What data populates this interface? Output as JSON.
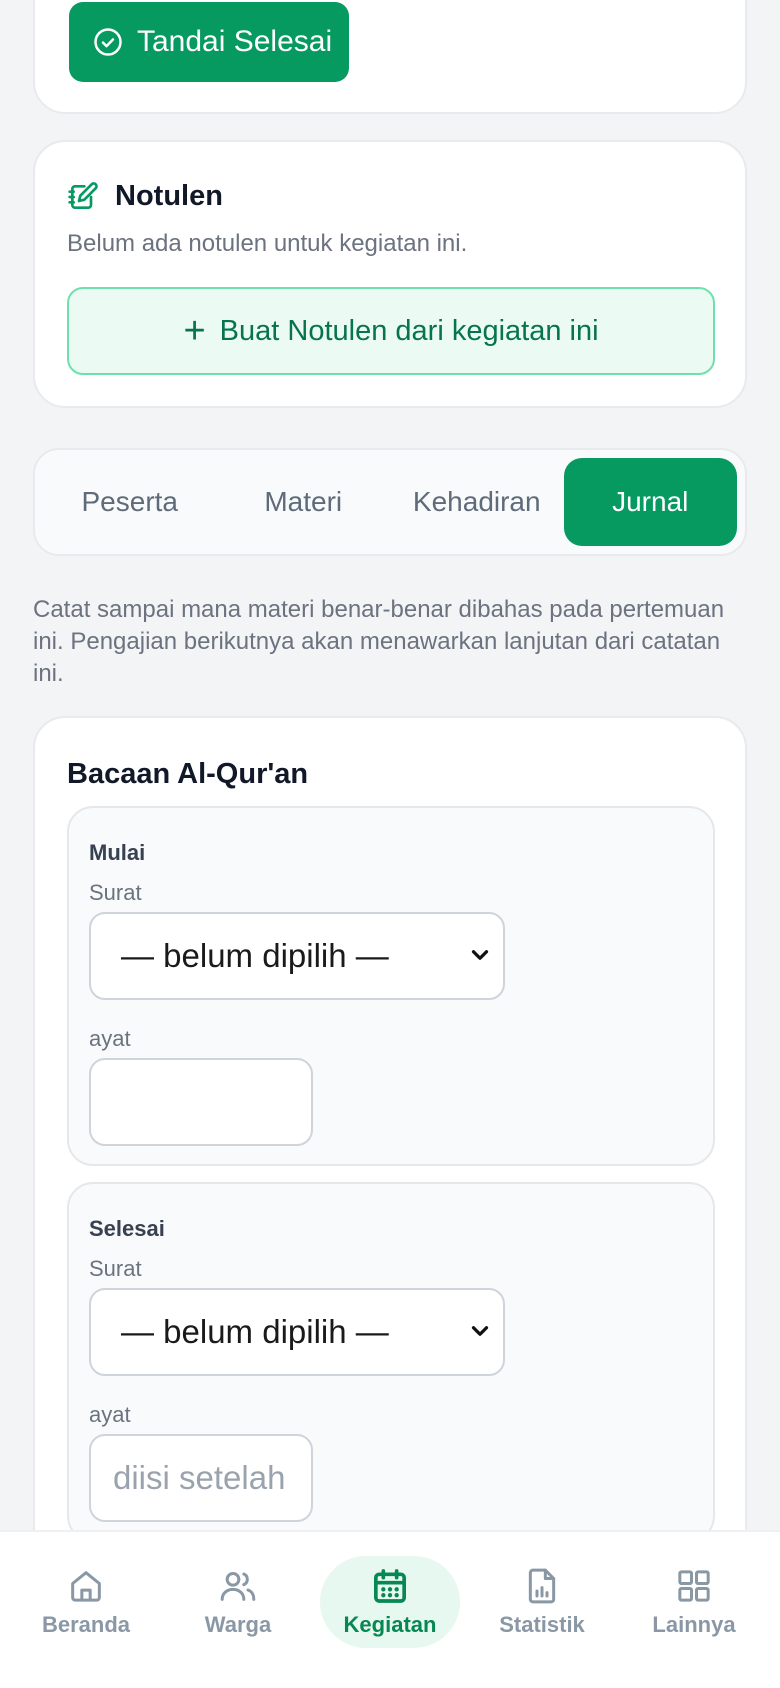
{
  "top_card": {
    "done_button": "Tandai Selesai"
  },
  "notulen": {
    "title": "Notulen",
    "empty_text": "Belum ada notulen untuk kegiatan ini.",
    "create_button": "Buat Notulen dari kegiatan ini"
  },
  "tabs": [
    {
      "label": "Peserta",
      "active": false
    },
    {
      "label": "Materi",
      "active": false
    },
    {
      "label": "Kehadiran",
      "active": false
    },
    {
      "label": "Jurnal",
      "active": true
    }
  ],
  "jurnal_description": "Catat sampai mana materi benar-benar dibahas pada pertemuan ini. Pengajian berikutnya akan menawarkan lanjutan dari catatan ini.",
  "bacaan": {
    "title": "Bacaan Al-Qur'an",
    "mulai": {
      "title": "Mulai",
      "surat_label": "Surat",
      "surat_value": "— belum dipilih —",
      "ayat_label": "ayat",
      "ayat_value": "",
      "ayat_placeholder": ""
    },
    "selesai": {
      "title": "Selesai",
      "surat_label": "Surat",
      "surat_value": "— belum dipilih —",
      "ayat_label": "ayat",
      "ayat_value": "",
      "ayat_placeholder": "diisi setelah"
    }
  },
  "nav": [
    {
      "label": "Beranda",
      "icon": "home-icon",
      "active": false
    },
    {
      "label": "Warga",
      "icon": "users-icon",
      "active": false
    },
    {
      "label": "Kegiatan",
      "icon": "calendar-icon",
      "active": true
    },
    {
      "label": "Statistik",
      "icon": "chart-file-icon",
      "active": false
    },
    {
      "label": "Lainnya",
      "icon": "grid-icon",
      "active": false
    }
  ],
  "colors": {
    "primary": "#069a61",
    "primary_light": "#ebfbf3",
    "muted": "#6b7280"
  }
}
